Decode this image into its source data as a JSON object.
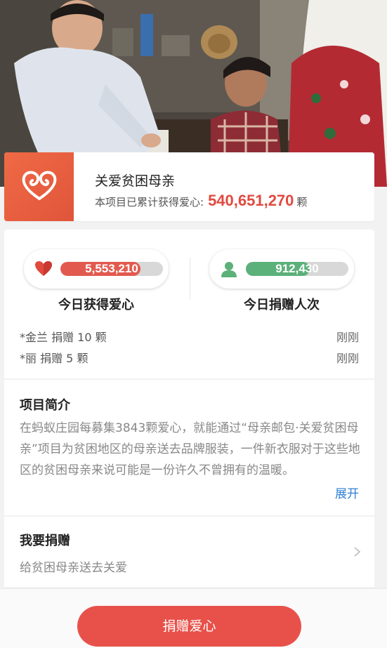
{
  "project": {
    "title": "关爱贫困母亲",
    "accumulated_label": "本项目已累计获得爱心:",
    "accumulated_count": "540,651,270",
    "unit": "颗",
    "logo_icon": "heart-ribbon-icon"
  },
  "stats": {
    "hearts": {
      "value": "5,553,210",
      "label": "今日获得爱心",
      "icon": "heart-icon",
      "color": "#e25a4f",
      "fill_fraction": 0.78
    },
    "donors": {
      "value": "912,430",
      "label": "今日捐赠人次",
      "icon": "person-icon",
      "color": "#5cb07a",
      "fill_fraction": 0.62
    }
  },
  "recent_donations": [
    {
      "text": "*金兰 捐赠 10 颗",
      "time": "刚刚"
    },
    {
      "text": "*丽 捐赠 5 颗",
      "time": "刚刚"
    }
  ],
  "intro": {
    "title": "项目简介",
    "text": "在蚂蚁庄园每募集3843颗爱心，就能通过“母亲邮包·关爱贫困母亲”项目为贫困地区的母亲送去品牌服装，一件新衣服对于这些地区的贫困母亲来说可能是一份许久不曾拥有的温暖。",
    "expand_label": "展开"
  },
  "donate": {
    "title": "我要捐赠",
    "subtitle": "给贫困母亲送去关爱"
  },
  "bottom": {
    "button_label": "捐赠爱心"
  }
}
